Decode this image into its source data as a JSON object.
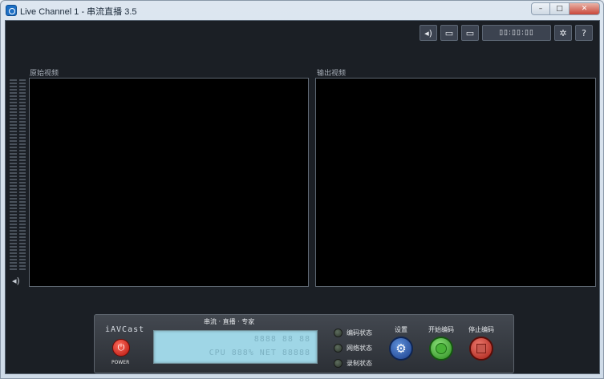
{
  "window": {
    "title": "Live Channel 1 - 串流直播 3.5",
    "buttons": {
      "minimize": "–",
      "maximize": "□",
      "close": "✕"
    }
  },
  "toolbar": {
    "items": [
      {
        "name": "volume",
        "icon": "speaker-icon",
        "glyph": "◂)"
      },
      {
        "name": "monitor-1",
        "icon": "monitor-icon",
        "glyph": "▭"
      },
      {
        "name": "monitor-2",
        "icon": "monitor-icon",
        "glyph": "▭"
      },
      {
        "name": "time",
        "glyph": "▯▯:▯▯:▯▯"
      },
      {
        "name": "settings",
        "icon": "gear-icon",
        "glyph": "✲"
      },
      {
        "name": "help",
        "icon": "help-icon",
        "glyph": "?"
      }
    ]
  },
  "panels": {
    "source_label": "原始视频",
    "output_label": "输出视频"
  },
  "console": {
    "brand": "iAVCast",
    "power_label": "POWER",
    "slogan": "串流 · 直播 · 专家",
    "lcd": {
      "line1": "8888 88 88",
      "line2": "CPU 888% NET 88888"
    },
    "status": [
      "编码状态",
      "网络状态",
      "录制状态"
    ],
    "settings_label": "设置",
    "start_label": "开始编码",
    "stop_label": "停止编码"
  },
  "colors": {
    "background": "#1b1f25",
    "lcd": "#9fd6e6",
    "power": "#d32a1e",
    "start": "#3fa52e",
    "stop": "#c2392e",
    "settings": "#2e5db0"
  }
}
